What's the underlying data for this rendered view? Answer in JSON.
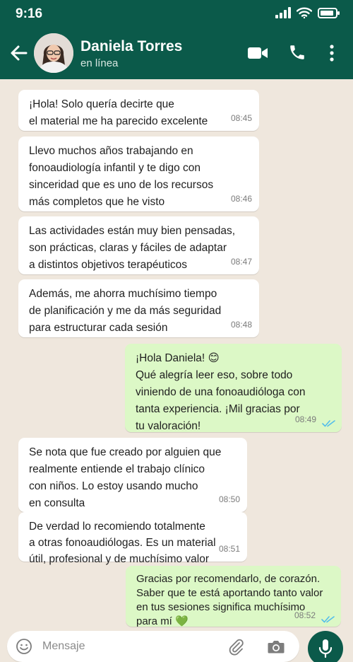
{
  "status_bar": {
    "time": "9:16"
  },
  "header": {
    "contact_name": "Daniela Torres",
    "contact_status": "en línea"
  },
  "messages": [
    {
      "direction": "in",
      "text": "¡Hola! Solo quería decirte que\nel material me ha parecido excelente",
      "time": "08:45"
    },
    {
      "direction": "in",
      "text": "Llevo muchos años trabajando en\nfonoaudiología infantil y te digo con\nsinceridad que es uno de los recursos\nmás completos que he visto",
      "time": "08:46"
    },
    {
      "direction": "in",
      "text": "Las actividades están muy bien pensadas,\nson prácticas, claras y fáciles de adaptar\na distintos objetivos terapéuticos",
      "time": "08:47"
    },
    {
      "direction": "in",
      "text": "Además, me ahorra muchísimo tiempo\nde planificación y me da más seguridad\npara estructurar cada sesión",
      "time": "08:48"
    },
    {
      "direction": "out",
      "text": "¡Hola Daniela! 😊\nQué alegría leer eso, sobre todo\nviniendo de una fonoaudióloga con\ntanta experiencia. ¡Mil gracias por\ntu valoración!",
      "time": "08:49",
      "read": true
    },
    {
      "direction": "in",
      "text": "Se nota que fue creado por alguien que\nrealmente entiende el trabajo clínico\ncon niños. Lo estoy usando mucho\nen consulta",
      "time": "08:50"
    },
    {
      "direction": "in",
      "text": "De verdad lo recomiendo totalmente\na otras fonoaudiólogas. Es un material\nútil, profesional y de muchísimo valor",
      "time": "08:51"
    },
    {
      "direction": "out",
      "text": "Gracias por recomendarlo, de corazón.\nSaber que te está aportando tanto valor\nen tus sesiones significa muchísimo\npara mí 💚",
      "time": "08:52",
      "read": true
    }
  ],
  "input": {
    "placeholder": "Mensaje"
  },
  "icons": {
    "back": "arrow-left-icon",
    "video": "video-call-icon",
    "phone": "phone-icon",
    "menu": "more-vertical-icon",
    "emoji": "emoji-icon",
    "attach": "paperclip-icon",
    "camera": "camera-icon",
    "mic": "microphone-icon"
  },
  "colors": {
    "header": "#0b5a4a",
    "chat_background": "#efe7dd",
    "incoming_bubble": "#ffffff",
    "outgoing_bubble": "#dcf8c6",
    "read_ticks": "#53bdeb",
    "mic_button": "#0b5a4a"
  }
}
